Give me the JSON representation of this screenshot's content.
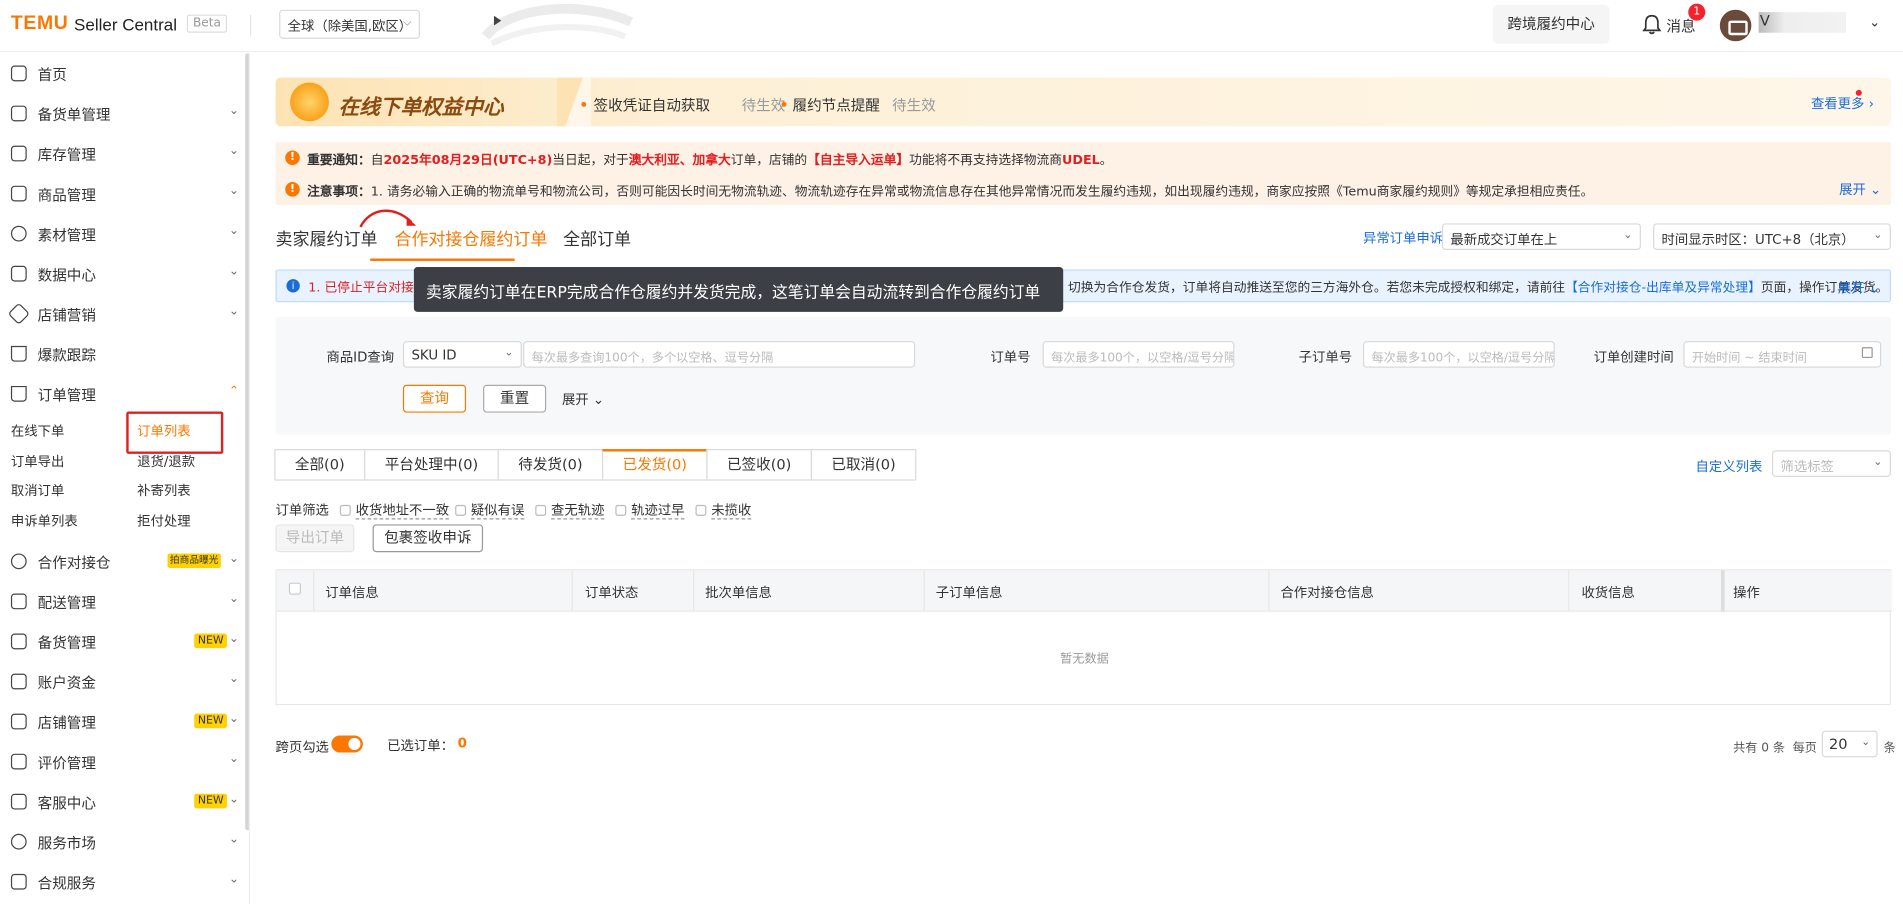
{
  "header": {
    "logo": "TEMU",
    "app_name": "Seller Central",
    "badge": "Beta",
    "region": "全球（除美国,欧区）",
    "cross_border_btn": "跨境履约中心",
    "messages_label": "消息",
    "messages_count": "1",
    "username": "V"
  },
  "sidebar": {
    "items": [
      {
        "label": "首页",
        "icon": "home-icon"
      },
      {
        "label": "备货单管理",
        "icon": "document-icon"
      },
      {
        "label": "库存管理",
        "icon": "warehouse-icon"
      },
      {
        "label": "商品管理",
        "icon": "shop-icon"
      },
      {
        "label": "素材管理",
        "icon": "bike-icon"
      },
      {
        "label": "数据中心",
        "icon": "table-icon"
      },
      {
        "label": "店铺营销",
        "icon": "tag-icon"
      },
      {
        "label": "爆款跟踪",
        "icon": "cart-icon"
      },
      {
        "label": "订单管理",
        "icon": "cart-icon"
      },
      {
        "label": "合作对接仓",
        "icon": "money-icon",
        "tag": "拍商品曝光"
      },
      {
        "label": "配送管理",
        "icon": "truck-icon"
      },
      {
        "label": "备货管理",
        "icon": "cart-plus-icon",
        "tag": "NEW"
      },
      {
        "label": "账户资金",
        "icon": "wallet-icon"
      },
      {
        "label": "店铺管理",
        "icon": "store-icon",
        "tag": "NEW"
      },
      {
        "label": "评价管理",
        "icon": "review-icon"
      },
      {
        "label": "客服中心",
        "icon": "service-icon",
        "tag": "NEW"
      },
      {
        "label": "服务市场",
        "icon": "market-icon"
      },
      {
        "label": "合规服务",
        "icon": "shield-icon"
      }
    ],
    "order_sub": {
      "left": [
        "在线下单",
        "订单导出",
        "取消订单",
        "申诉单列表"
      ],
      "right": [
        "订单列表",
        "退货/退款",
        "补寄列表",
        "拒付处理"
      ]
    }
  },
  "banner": {
    "title": "在线下单权益中心",
    "item1": "签收凭证自动获取",
    "item1_status": "待生效",
    "item2": "履约节点提醒",
    "item2_status": "待生效",
    "more": "查看更多"
  },
  "notice": {
    "n1_label": "重要通知：",
    "n1_a": "自",
    "n1_date": "2025年08月29日(UTC+8)",
    "n1_b": "当日起，对于",
    "n1_c": "澳大利亚、加拿大",
    "n1_d": "订单，店铺的",
    "n1_e": "【自主导入运单】",
    "n1_f": "功能将不再支持选择物流商",
    "n1_g": "UDEL",
    "n1_h": "。",
    "n2_label": "注意事项：",
    "n2_text": "1. 请务必输入正确的物流单号和物流公司，否则可能因长时间无物流轨迹、物流轨迹存在异常或物流信息存在其他异常情况而发生履约违规，如出现履约违规，商家应按照《Temu商家履约规则》等规定承担相应责任。",
    "expand": "展开"
  },
  "order_tabs": [
    "卖家履约订单",
    "合作对接仓履约订单",
    "全部订单"
  ],
  "appeal_link": "异常订单申诉",
  "sort_select": "最新成交订单在上",
  "timezone_select": "时间显示时区：UTC+8（北京）",
  "info_bar": {
    "text_left": "1. 已停止平台对接",
    "text_right": "切换为合作仓发货，订单将自动推送至您的三方海外仓。若您未完成授权和绑定，请前往",
    "link": "【合作对接仓-出库单及异常处理】",
    "text_end": "页面，操作订单发货。",
    "expand": "展开"
  },
  "tooltip": "卖家履约订单在ERP完成合作仓履约并发货完成，这笔订单会自动流转到合作仓履约订单",
  "filters": {
    "product_id_label": "商品ID查询",
    "product_id_type": "SKU ID",
    "product_id_placeholder": "每次最多查询100个，多个以空格、逗号分隔",
    "order_no_label": "订单号",
    "order_no_placeholder": "每次最多100个，以空格/逗号分隔",
    "sub_order_label": "子订单号",
    "sub_order_placeholder": "每次最多100个，以空格/逗号分隔",
    "created_label": "订单创建时间",
    "start_placeholder": "开始时间",
    "range_sep": "~",
    "end_placeholder": "结束时间",
    "query": "查询",
    "reset": "重置",
    "expand": "展开"
  },
  "status_tabs": [
    "全部(0)",
    "平台处理中(0)",
    "待发货(0)",
    "已发货(0)",
    "已签收(0)",
    "已取消(0)"
  ],
  "custom_columns": "自定义列表",
  "filter_tag_placeholder": "筛选标签",
  "order_filter": {
    "label": "订单筛选",
    "options": [
      "收货地址不一致",
      "疑似有误",
      "查无轨迹",
      "轨迹过早",
      "未揽收"
    ]
  },
  "actions": {
    "export": "导出订单",
    "appeal": "包裹签收申诉"
  },
  "table": {
    "columns": [
      "订单信息",
      "订单状态",
      "批次单信息",
      "子订单信息",
      "合作对接仓信息",
      "收货信息",
      "操作"
    ],
    "empty": "暂无数据"
  },
  "footer": {
    "cross_page": "跨页勾选",
    "selected_label": "已选订单：",
    "selected_count": "0",
    "total": "共有 0 条",
    "per_page_label": "每页",
    "per_page": "20",
    "unit": "条"
  },
  "colors": {
    "accent": "#fb7701",
    "link": "#1a6dd8",
    "danger": "#e02020"
  }
}
